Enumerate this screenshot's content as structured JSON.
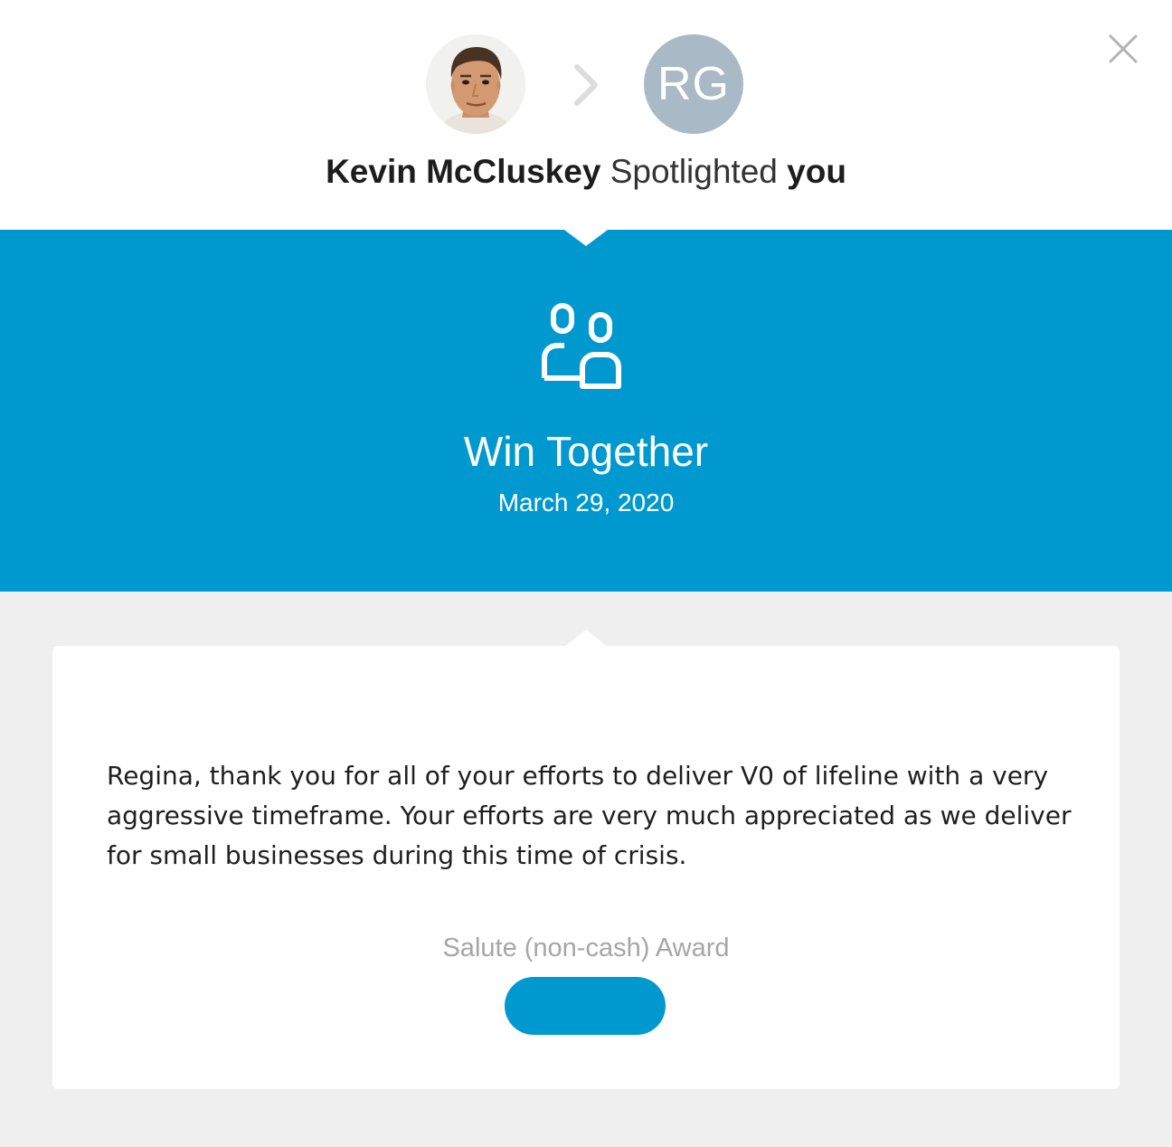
{
  "header": {
    "sender_name": "Kevin McCluskey",
    "action_text": "Spotlighted",
    "recipient_text": "you",
    "recipient_initials": "RG",
    "sender_avatar_alt": "Kevin McCluskey",
    "close_icon": "close-icon",
    "arrow_icon": "chevron-right-icon"
  },
  "award": {
    "icon": "team-icon",
    "title": "Win Together",
    "date": "March 29, 2020"
  },
  "card": {
    "message": "Regina, thank you for all of your efforts to deliver V0 of lifeline with a very aggressive timeframe. Your efforts are very much appreciated as we deliver for small businesses during this time of crisis.",
    "award_type": "Salute (non-cash) Award",
    "award_value": ""
  },
  "colors": {
    "accent": "#0099cf",
    "initials_avatar": "#a9bac6",
    "page_background": "#efefef"
  }
}
